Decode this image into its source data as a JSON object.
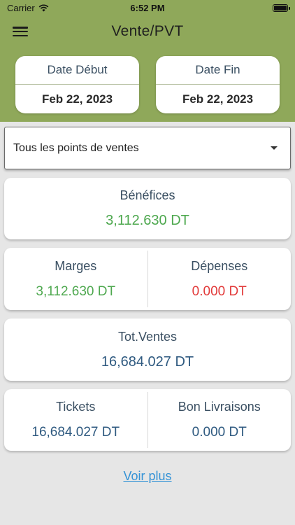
{
  "status_bar": {
    "carrier": "Carrier",
    "time": "6:52 PM"
  },
  "header": {
    "title": "Vente/PVT",
    "menu_icon": "hamburger-icon"
  },
  "dates": {
    "start_label": "Date Début",
    "start_value": "Feb 22, 2023",
    "end_label": "Date Fin",
    "end_value": "Feb 22, 2023"
  },
  "dropdown": {
    "selected": "Tous les points de ventes"
  },
  "benefices": {
    "label": "Bénéfices",
    "value": "3,112.630 DT"
  },
  "marges": {
    "label": "Marges",
    "value": "3,112.630 DT"
  },
  "depenses": {
    "label": "Dépenses",
    "value": "0.000 DT"
  },
  "tot_ventes": {
    "label": "Tot.Ventes",
    "value": "16,684.027 DT"
  },
  "tickets": {
    "label": "Tickets",
    "value": "16,684.027 DT"
  },
  "bon_livraisons": {
    "label": "Bon Livraisons",
    "value": "0.000 DT"
  },
  "voir_plus": "Voir plus",
  "colors": {
    "header_bg": "#8fa85a",
    "positive": "#4ea84f",
    "negative": "#e23b3b",
    "neutral_value": "#2f5a80",
    "label": "#3a4f62",
    "link": "#3593d6"
  }
}
